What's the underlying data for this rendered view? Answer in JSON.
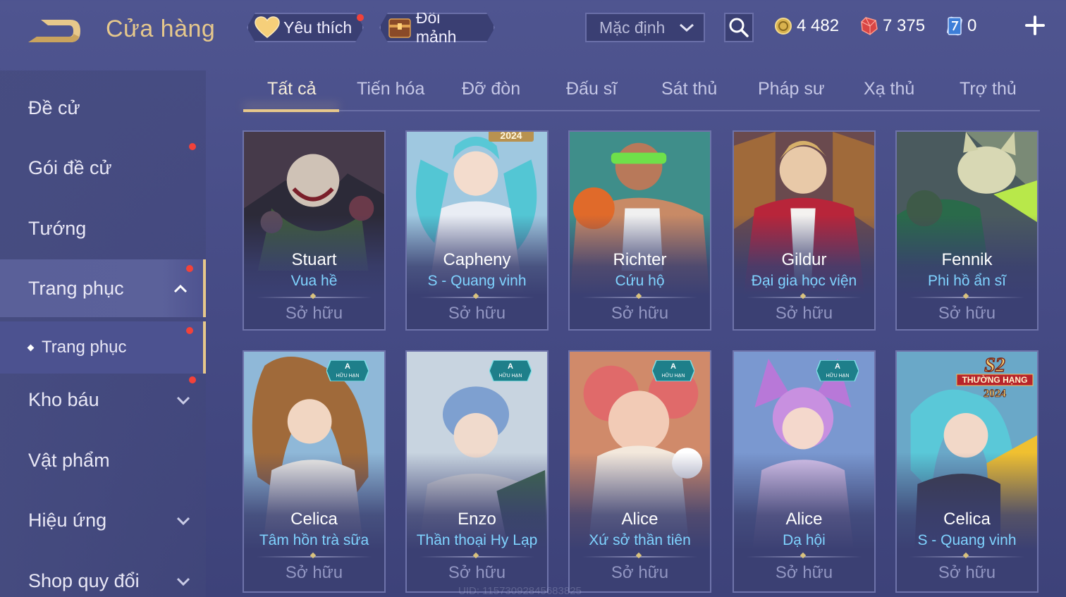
{
  "header": {
    "title": "Cửa hàng",
    "favorite_label": "Yêu thích",
    "exchange_label": "Đổi mảnh",
    "sort_label": "Mặc định",
    "currencies": {
      "gold": "4 482",
      "ruby": "7 375",
      "voucher": "0"
    }
  },
  "sidebar": {
    "items": [
      {
        "label": "Đề cử"
      },
      {
        "label": "Gói đề cử"
      },
      {
        "label": "Tướng"
      },
      {
        "label": "Trang phục"
      },
      {
        "label": "Trang phục"
      },
      {
        "label": "Kho báu"
      },
      {
        "label": "Vật phẩm"
      },
      {
        "label": "Hiệu ứng"
      },
      {
        "label": "Shop quy đổi"
      }
    ]
  },
  "tabs": [
    "Tất cả",
    "Tiến hóa",
    "Đỡ đòn",
    "Đấu sĩ",
    "Sát thủ",
    "Pháp sư",
    "Xạ thủ",
    "Trợ thủ"
  ],
  "cards": [
    {
      "hero": "Stuart",
      "skin": "Vua hề",
      "status": "Sở hữu",
      "badge": ""
    },
    {
      "hero": "Capheny",
      "skin": "S - Quang vinh",
      "status": "Sở hữu",
      "badge": "2024"
    },
    {
      "hero": "Richter",
      "skin": "Cứu hộ",
      "status": "Sở hữu",
      "badge": ""
    },
    {
      "hero": "Gildur",
      "skin": "Đại gia học viện",
      "status": "Sở hữu",
      "badge": ""
    },
    {
      "hero": "Fennik",
      "skin": "Phi hồ ẩn sĩ",
      "status": "Sở hữu",
      "badge": ""
    },
    {
      "hero": "Celica",
      "skin": "Tâm hồn trà sữa",
      "status": "Sở hữu",
      "badge": "A",
      "badge_sub": "HỮU HẠN"
    },
    {
      "hero": "Enzo",
      "skin": "Thần thoại Hy Lạp",
      "status": "Sở hữu",
      "badge": "A",
      "badge_sub": "HỮU HẠN"
    },
    {
      "hero": "Alice",
      "skin": "Xứ sở thần tiên",
      "status": "Sở hữu",
      "badge": "A",
      "badge_sub": "HỮU HẠN"
    },
    {
      "hero": "Alice",
      "skin": "Dạ hội",
      "status": "Sở hữu",
      "badge": "A",
      "badge_sub": "HỮU HẠN"
    },
    {
      "hero": "Celica",
      "skin": "S - Quang vinh",
      "status": "Sở hữu",
      "badge": "S2",
      "badge_sub": "THƯỜNG HẠNG",
      "badge_year": "2024"
    }
  ],
  "uid_text": "UID: 115730928456838​25",
  "colors": {
    "accent_gold": "#e7c88b",
    "skin_name": "#7fd3ff",
    "notify": "#f2423a"
  }
}
